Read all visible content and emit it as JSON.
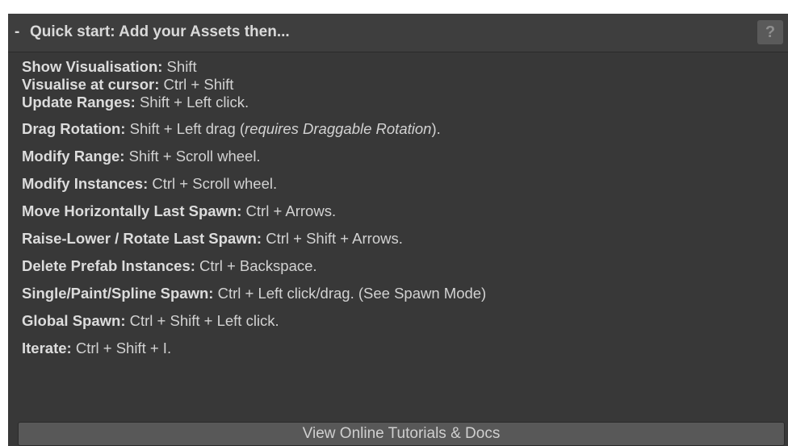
{
  "header": {
    "toggle": "-",
    "title": "Quick start: Add your Assets then...",
    "help_label": "?"
  },
  "shortcuts": [
    {
      "key": "Show Visualisation:",
      "value": " Shift"
    },
    {
      "key": "Visualise at cursor:",
      "value": " Ctrl + Shift"
    },
    {
      "key": "Update Ranges:",
      "value": " Shift + Left click."
    },
    {
      "key": "Drag Rotation:",
      "value": " Shift + Left drag (",
      "italic": "requires Draggable Rotation",
      "suffix": ")."
    },
    {
      "key": "Modify Range:",
      "value": " Shift + Scroll wheel."
    },
    {
      "key": "Modify Instances:",
      "value": " Ctrl + Scroll wheel."
    },
    {
      "key": "Move Horizontally Last Spawn:",
      "value": " Ctrl + Arrows."
    },
    {
      "key": "Raise-Lower / Rotate Last Spawn:",
      "value": " Ctrl + Shift + Arrows."
    },
    {
      "key": "Delete Prefab Instances:",
      "value": " Ctrl + Backspace."
    },
    {
      "key": "Single/Paint/Spline Spawn:",
      "value": " Ctrl + Left click/drag. (See Spawn Mode)"
    },
    {
      "key": "Global Spawn:",
      "value": " Ctrl + Shift + Left click."
    },
    {
      "key": "Iterate:",
      "value": " Ctrl + Shift + I."
    }
  ],
  "footer": {
    "tutorial_button": "View Online Tutorials & Docs"
  }
}
